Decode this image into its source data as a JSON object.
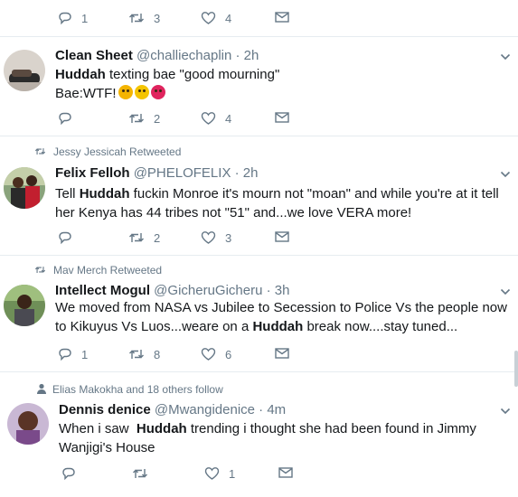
{
  "colors": {
    "name": "#14171a",
    "meta": "#657786",
    "divider": "#e6ecf0",
    "accent": "#1da1f2"
  },
  "tweets": [
    {
      "actions": {
        "reply": "1",
        "retweet": "3",
        "like": "4"
      }
    },
    {
      "name": "Clean Sheet",
      "handle": "@challiechaplin",
      "time": "· 2h",
      "text_strong": "Huddah",
      "text_rest": " texting bae \"good mourning\"",
      "text_line2": "Bae:WTF!",
      "emoji": [
        "angry-face-icon",
        "grimacing-face-icon",
        "rage-face-icon"
      ],
      "actions": {
        "reply": "",
        "retweet": "2",
        "like": "4"
      }
    },
    {
      "context": "Jessy Jessicah Retweeted",
      "name": "Felix Felloh",
      "handle": "@PHELOFELIX",
      "time": "· 2h",
      "text_pre": "Tell ",
      "text_strong": "Huddah",
      "text_rest": " fuckin Monroe it's mourn not \"moan\" and while you're at it tell her Kenya has 44 tribes not \"51\" and...we love VERA more!",
      "actions": {
        "reply": "",
        "retweet": "2",
        "like": "3"
      }
    },
    {
      "context": "Mav Merch Retweeted",
      "name": "Intellect Mogul",
      "handle": "@GicheruGicheru",
      "time": "· 3h",
      "text_pre": "We moved from NASA vs Jubilee to Secession to Police Vs the people now to Kikuyus Vs Luos...weare on a ",
      "text_strong": "Huddah",
      "text_rest": " break now....stay tuned...",
      "actions": {
        "reply": "1",
        "retweet": "8",
        "like": "6"
      }
    },
    {
      "context": "Elias Makokha and 18 others follow",
      "name": "Dennis denice",
      "handle": "@Mwangidenice",
      "time": "· 4m",
      "text_pre": "When i saw  ",
      "text_strong": "Huddah",
      "text_rest": " trending i thought she had been found in Jimmy Wanjigi's House",
      "actions": {
        "reply": "",
        "retweet": "",
        "like": "1"
      }
    }
  ]
}
